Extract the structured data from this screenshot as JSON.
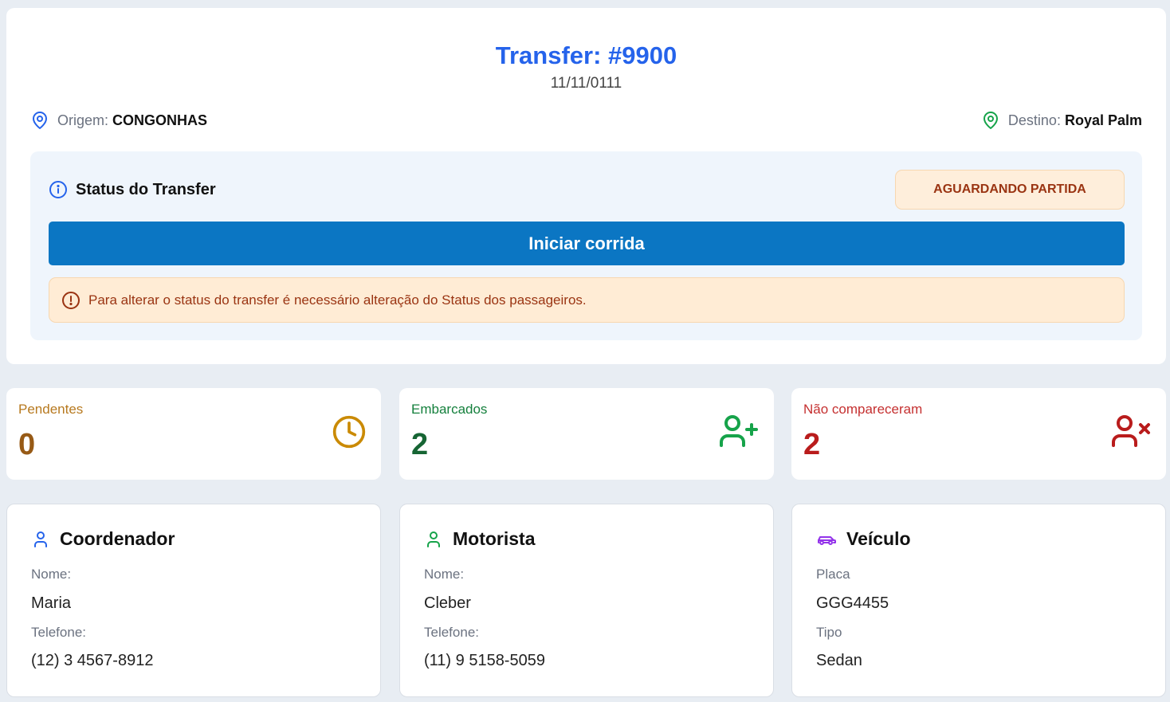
{
  "transfer": {
    "title": "Transfer: #9900",
    "date": "11/11/0111",
    "origin_label": "Origem:",
    "origin_value": "CONGONHAS",
    "dest_label": "Destino:",
    "dest_value": "Royal Palm"
  },
  "status": {
    "heading": "Status do Transfer",
    "badge": "AGUARDANDO PARTIDA",
    "start_button": "Iniciar corrida",
    "alert": "Para alterar o status do transfer é necessário alteração do Status dos passageiros."
  },
  "stats": [
    {
      "label": "Pendentes",
      "value": "0",
      "color": "#b7791f",
      "value_color": "#975a16"
    },
    {
      "label": "Embarcados",
      "value": "2",
      "color": "#15803d",
      "value_color": "#166534"
    },
    {
      "label": "Não compareceram",
      "value": "2",
      "color": "#c53030",
      "value_color": "#b91c1c"
    }
  ],
  "coordinator": {
    "heading": "Coordenador",
    "name_label": "Nome:",
    "name": "Maria",
    "phone_label": "Telefone:",
    "phone": "(12) 3 4567-8912"
  },
  "driver": {
    "heading": "Motorista",
    "name_label": "Nome:",
    "name": "Cleber",
    "phone_label": "Telefone:",
    "phone": "(11) 9 5158-5059"
  },
  "vehicle": {
    "heading": "Veículo",
    "plate_label": "Placa",
    "plate": "GGG4455",
    "type_label": "Tipo",
    "type": "Sedan"
  },
  "icons": {
    "origin": "map-pin-icon",
    "destination": "map-pin-icon",
    "status": "info-icon",
    "alert": "alert-circle-icon",
    "pending": "clock-icon",
    "boarded": "user-plus-icon",
    "no_show": "user-x-icon",
    "coordinator": "user-icon",
    "driver": "user-icon",
    "vehicle": "car-icon"
  }
}
